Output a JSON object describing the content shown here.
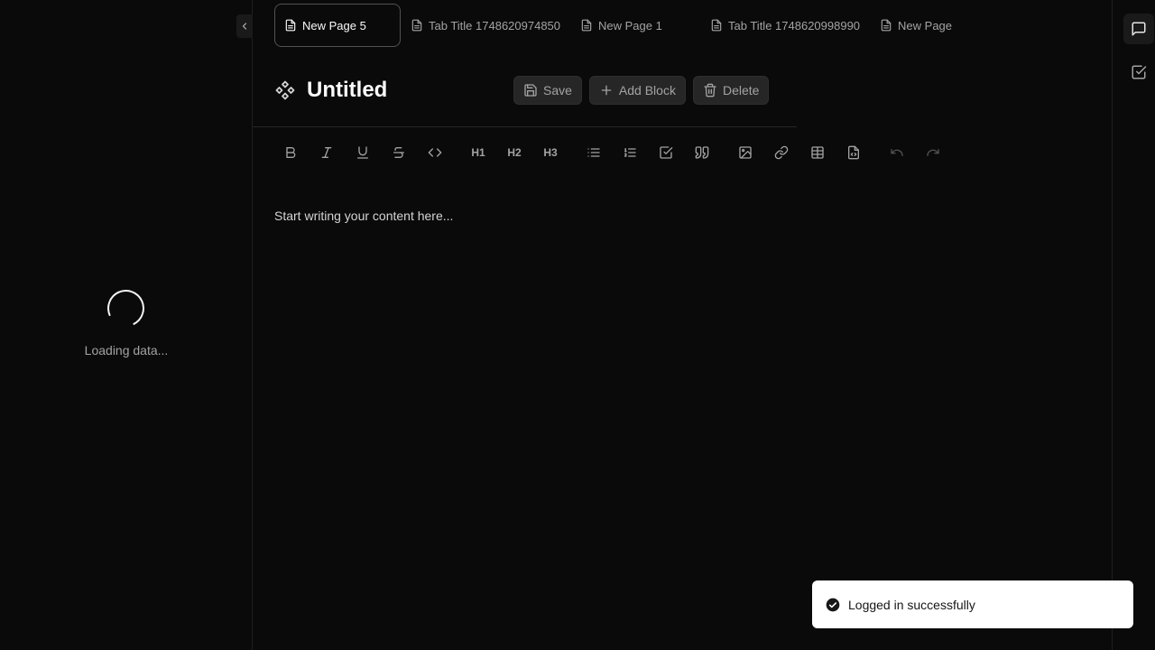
{
  "sidebar": {
    "loading_text": "Loading data..."
  },
  "tabs": [
    {
      "label": "New Page 5",
      "active": true
    },
    {
      "label": "Tab Title 1748620974850",
      "active": false
    },
    {
      "label": "New Page 1",
      "active": false
    },
    {
      "label": "Tab Title 1748620998990",
      "active": false
    },
    {
      "label": "New Page",
      "active": false
    }
  ],
  "page": {
    "title": "Untitled"
  },
  "actions": {
    "save_label": "Save",
    "add_block_label": "Add Block",
    "delete_label": "Delete"
  },
  "toolbar": {
    "h1": "H1",
    "h2": "H2",
    "h3": "H3"
  },
  "editor": {
    "placeholder": "Start writing your content here..."
  },
  "toast": {
    "message": "Logged in successfully"
  },
  "colors": {
    "background": "#0a0a0a",
    "surface": "#262626",
    "text": "#e5e5e5",
    "muted": "#a3a3a3",
    "toast_bg": "#ffffff"
  }
}
